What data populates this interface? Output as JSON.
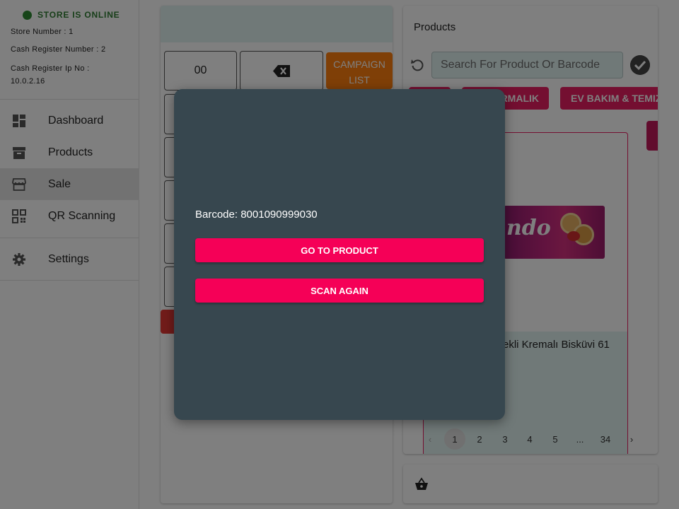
{
  "sidebar": {
    "status": "STORE IS ONLINE",
    "store_number": "Store Number : 1",
    "cash_register_number": "Cash Register Number : 2",
    "cash_register_ip_label": "Cash Register Ip No :",
    "cash_register_ip": "10.0.2.16",
    "items": [
      {
        "label": "Dashboard",
        "icon": "dashboard-icon"
      },
      {
        "label": "Products",
        "icon": "archive-icon"
      },
      {
        "label": "Sale",
        "icon": "store-icon",
        "active": true
      },
      {
        "label": "QR Scanning",
        "icon": "qr-code-icon"
      },
      {
        "label": "Settings",
        "icon": "gear-icon"
      }
    ]
  },
  "keypad": {
    "double_zero": "00",
    "backspace_icon": "backspace-icon",
    "campaign_line1": "CAMPAIGN",
    "campaign_line2": "LIST"
  },
  "products": {
    "title": "Products",
    "search_placeholder": "Search For Product Or Barcode",
    "categories": [
      "",
      "RMALIK",
      "EV BAKIM & TEMIZ"
    ],
    "card_name": "ekli Kremalı Bisküvi 61",
    "card_brand": "ndo",
    "pagination": [
      "1",
      "2",
      "3",
      "4",
      "5",
      "...",
      "34"
    ],
    "current_page": "1"
  },
  "modal": {
    "barcode_text": "Barcode: 8001090999030",
    "go_to_product": "GO TO PRODUCT",
    "scan_again": "SCAN AGAIN"
  },
  "colors": {
    "accent": "#f50057",
    "online": "#2e7d32",
    "campaign": "#ff7f0e",
    "modal_bg": "#37474f"
  }
}
